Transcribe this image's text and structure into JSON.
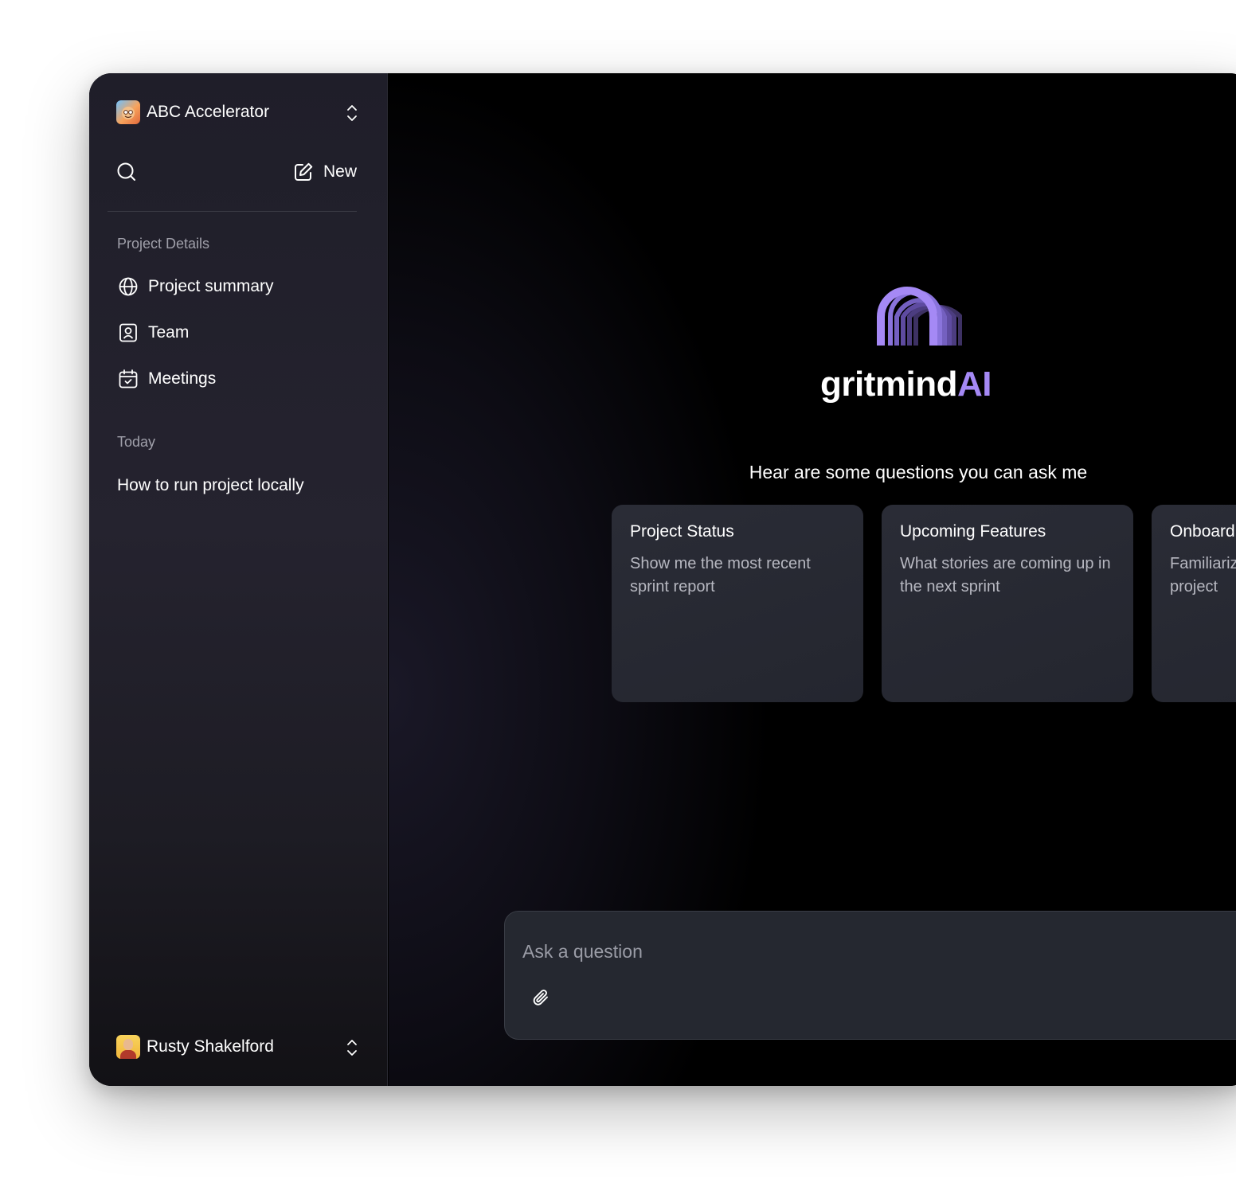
{
  "workspace": {
    "name": "ABC Accelerator",
    "avatar_icon": "workspace-avatar-icon"
  },
  "toolbar": {
    "new_label": "New"
  },
  "sidebar": {
    "sections": [
      {
        "label": "Project Details"
      },
      {
        "label": "Today"
      }
    ],
    "nav_items": [
      {
        "label": "Project summary",
        "icon": "globe-icon"
      },
      {
        "label": "Team",
        "icon": "contact-icon"
      },
      {
        "label": "Meetings",
        "icon": "calendar-check-icon"
      }
    ],
    "history": [
      {
        "label": "How to run project locally"
      }
    ]
  },
  "user": {
    "name": "Rusty Shakelford"
  },
  "brand": {
    "word": "gritmind",
    "suffix": "AI",
    "accent_color": "#a589f5"
  },
  "main": {
    "prompt_title": "Hear are some questions you can ask me"
  },
  "cards": [
    {
      "title": "Project Status",
      "description": "Show me the most recent sprint report"
    },
    {
      "title": "Upcoming Features",
      "description": "What stories are coming up in the next sprint"
    },
    {
      "title": "Onboarding",
      "description": "Familiarize me with the project"
    }
  ],
  "composer": {
    "placeholder": "Ask a question"
  }
}
